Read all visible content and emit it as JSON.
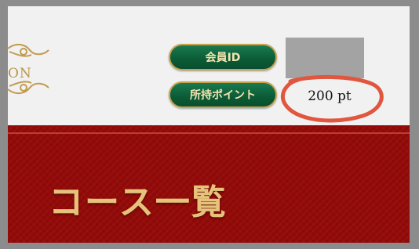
{
  "header": {
    "logo_text": "ON",
    "member_id_label": "会員ID",
    "points_label": "所持ポイント",
    "points_value": "200 pt"
  },
  "banner": {
    "title": "コース一覧"
  },
  "colors": {
    "accent_green": "#0b5b36",
    "gold": "#c7a24d",
    "banner_red": "#930a08",
    "annotation_red": "#e0563e"
  }
}
